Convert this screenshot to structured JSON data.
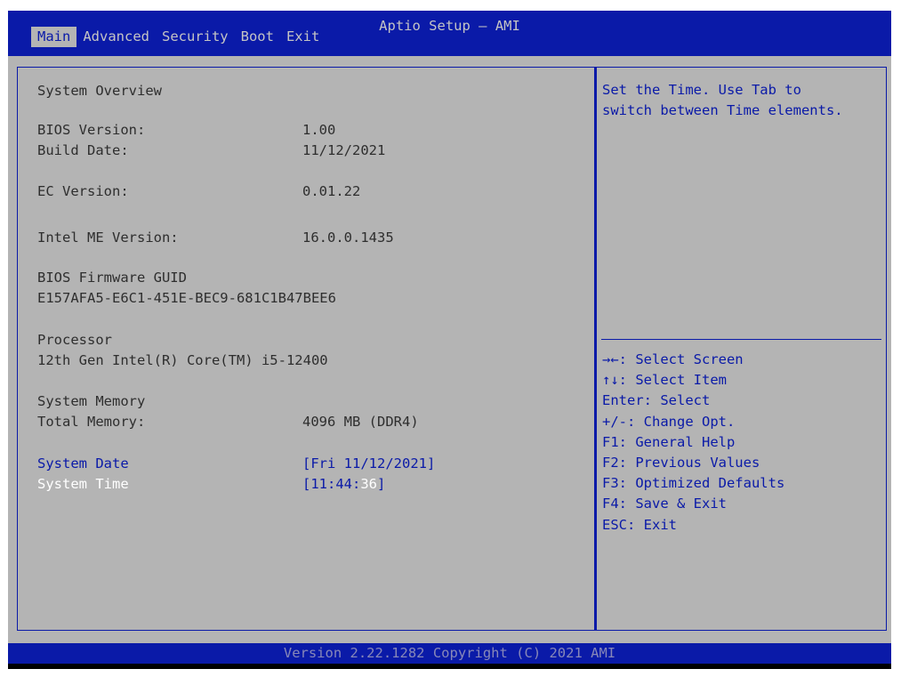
{
  "header": {
    "title": "Aptio Setup – AMI",
    "tabs": [
      "Main",
      "Advanced",
      "Security",
      "Boot",
      "Exit"
    ]
  },
  "main": {
    "system_overview": "System Overview",
    "bios_version_label": "BIOS Version:",
    "bios_version_value": "1.00",
    "build_date_label": "Build Date:",
    "build_date_value": "11/12/2021",
    "ec_version_label": "EC Version:",
    "ec_version_value": "0.01.22",
    "me_version_label": "Intel ME Version:",
    "me_version_value": "16.0.0.1435",
    "guid_label": "BIOS Firmware GUID",
    "guid_value": "E157AFA5-E6C1-451E-BEC9-681C1B47BEE6",
    "processor_label": "Processor",
    "processor_value": "12th Gen Intel(R) Core(TM) i5-12400",
    "memory_label": "System Memory",
    "total_memory_label": "Total Memory:",
    "total_memory_value": "4096 MB (DDR4)",
    "system_date_label": "System Date",
    "system_date_value": "[Fri 11/12/2021]",
    "system_time_label": "System Time",
    "system_time_value_h": "[11:44:",
    "system_time_value_s": "36",
    "system_time_value_end": "]"
  },
  "help": {
    "line1": "Set the Time. Use Tab to",
    "line2": "switch between Time elements.",
    "keys": [
      "→←: Select Screen",
      "↑↓: Select Item",
      "Enter: Select",
      "+/-: Change Opt.",
      "F1: General Help",
      "F2: Previous Values",
      "F3: Optimized Defaults",
      "F4: Save & Exit",
      "ESC: Exit"
    ]
  },
  "footer": {
    "text": "Version 2.22.1282 Copyright (C) 2021 AMI"
  },
  "colors": {
    "blue": "#0a1aa8",
    "gray": "#b4b4b4",
    "text": "#2e2e2e",
    "highlight": "#ffffff"
  }
}
